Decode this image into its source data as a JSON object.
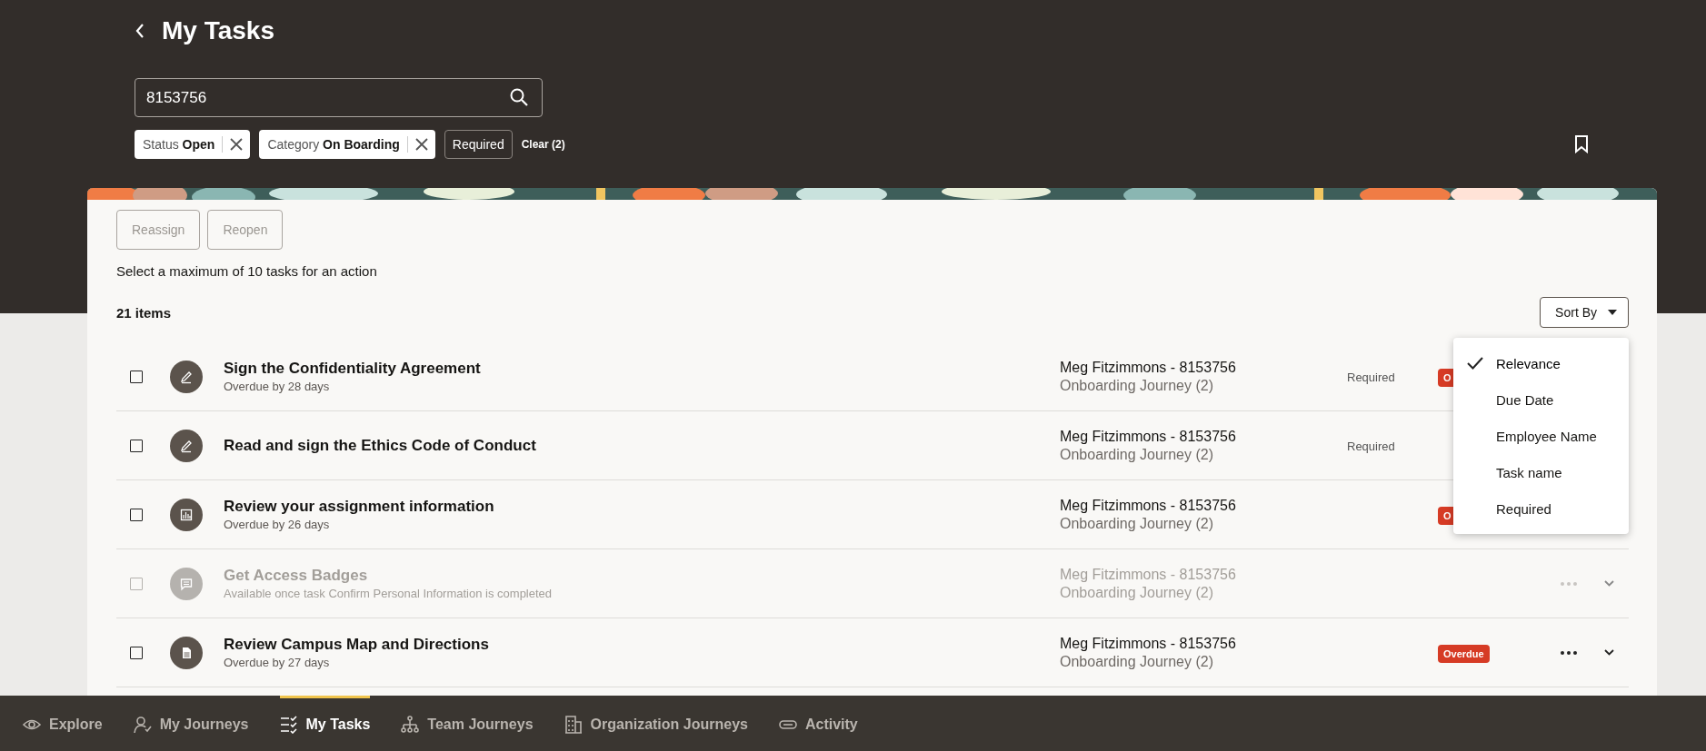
{
  "header": {
    "title": "My Tasks",
    "search": {
      "value": "8153756"
    },
    "filters": [
      {
        "kind": "chip",
        "label": "Status",
        "value": "Open"
      },
      {
        "kind": "chip",
        "label": "Category",
        "value": "On Boarding"
      },
      {
        "kind": "toggle",
        "label": "Required"
      }
    ],
    "clear_link": "Clear (2)"
  },
  "actions": [
    {
      "label": "Reassign",
      "disabled": true
    },
    {
      "label": "Reopen",
      "disabled": true
    }
  ],
  "hint": "Select a maximum of 10 tasks for an action",
  "count": "21 items",
  "sort": {
    "label": "Sort By",
    "expanded": true,
    "options": [
      {
        "label": "Relevance",
        "selected": true
      },
      {
        "label": "Due Date",
        "selected": false
      },
      {
        "label": "Employee Name",
        "selected": false
      },
      {
        "label": "Task name",
        "selected": false
      },
      {
        "label": "Required",
        "selected": false
      }
    ]
  },
  "tasks": [
    {
      "kind": "pen",
      "title": "Sign the Confidentiality Agreement",
      "subtitle": "Overdue by 28 days",
      "person": "Meg Fitzimmons - 8153756",
      "journey": "Onboarding Journey (2)",
      "required": "Required",
      "badge": "O",
      "checked": false,
      "disabled": false,
      "menu": false
    },
    {
      "kind": "pen",
      "title": "Read and sign the Ethics Code of Conduct",
      "person": "Meg Fitzimmons - 8153756",
      "journey": "Onboarding Journey (2)",
      "required": "Required",
      "checked": false,
      "disabled": false,
      "menu": false
    },
    {
      "kind": "chart",
      "title": "Review your assignment information",
      "subtitle": "Overdue by 26 days",
      "person": "Meg Fitzimmons - 8153756",
      "journey": "Onboarding Journey (2)",
      "badge": "O",
      "checked": false,
      "disabled": false,
      "menu": false
    },
    {
      "kind": "chat",
      "title": "Get Access Badges",
      "subtitle": "Available once task Confirm Personal Information is completed",
      "person": "Meg Fitzimmons - 8153756",
      "journey": "Onboarding Journey (2)",
      "checked": false,
      "disabled": true,
      "menu": true
    },
    {
      "kind": "doc",
      "title": "Review Campus Map and Directions",
      "subtitle": "Overdue by 27 days",
      "person": "Meg Fitzimmons - 8153756",
      "journey": "Onboarding Journey (2)",
      "badge": "Overdue",
      "checked": false,
      "disabled": false,
      "menu": true
    }
  ],
  "nav": [
    {
      "kind": "eye",
      "label": "Explore",
      "selected": false
    },
    {
      "kind": "person",
      "label": "My Journeys",
      "selected": false
    },
    {
      "kind": "list",
      "label": "My Tasks",
      "selected": true
    },
    {
      "kind": "tree",
      "label": "Team Journeys",
      "selected": false
    },
    {
      "kind": "building",
      "label": "Organization Journeys",
      "selected": false
    },
    {
      "kind": "link",
      "label": "Activity",
      "selected": false
    }
  ]
}
